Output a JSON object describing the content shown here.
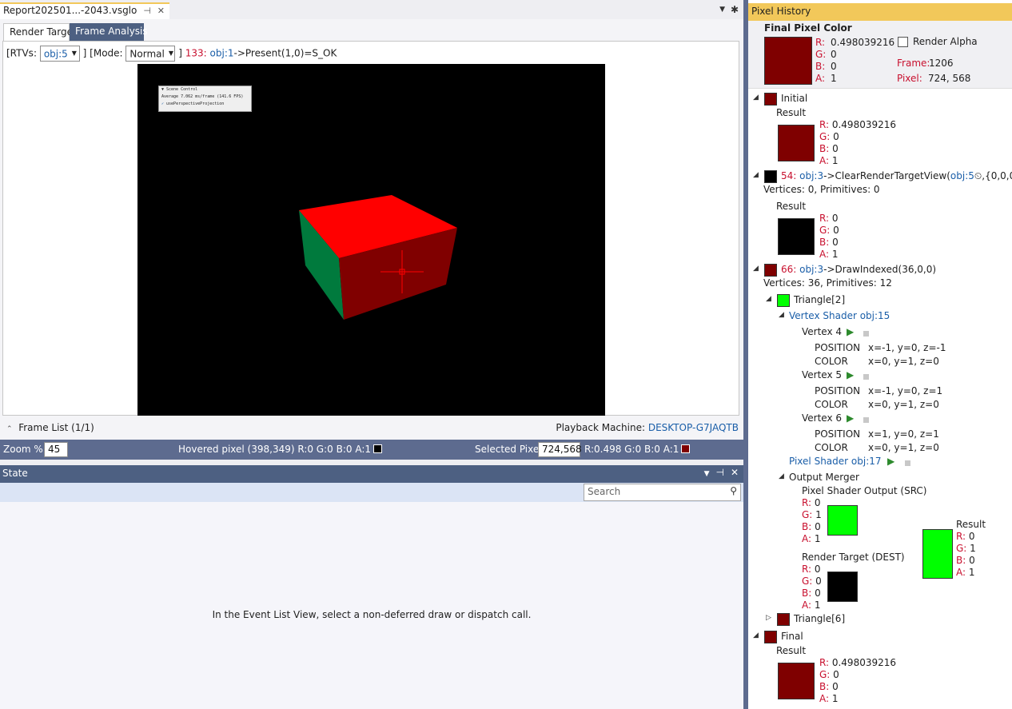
{
  "document_tab": {
    "title": "Report202501...-2043.vsglog",
    "pin": "⊣",
    "close": "✕",
    "menu": "▼",
    "gear": "✱"
  },
  "subtabs": {
    "render_target": "Render Target",
    "frame_analysis": "Frame Analysis"
  },
  "rtv_bar": {
    "rtvs_label": "[RTVs:",
    "rtv_value": "obj:5",
    "close_bracket": "]",
    "mode_label": "[Mode:",
    "mode_value": "Normal",
    "close_bracket2": "]",
    "call_index": "133:",
    "call_obj": "obj:1",
    "call_text": "->Present(1,0)=S_OK"
  },
  "scene_overlay": {
    "title": "▼ Scene Control",
    "line1": "Average 7.062 ms/frame (141.6 FPS)",
    "line2": "usePerspectiveProjection",
    "check": "✓"
  },
  "frame_list": {
    "label": "Frame List (1/1)",
    "playback_label": "Playback Machine:",
    "playback_value": "DESKTOP-G7JAQTB"
  },
  "zoom_bar": {
    "zoom_label": "Zoom %",
    "zoom_value": "45",
    "hovered_label": "Hovered pixel (398,349) R:0 G:0 B:0 A:1",
    "hovered_color": "#000000",
    "selected_label": "Selected Pixel",
    "selected_value": "724,568",
    "selected_rgba": "R:0.498 G:0 B:0 A:1",
    "selected_color": "#7f0000"
  },
  "state": {
    "title": "State",
    "search_placeholder": "Search",
    "empty_message": "In the Event List View, select a non-deferred draw or dispatch call."
  },
  "pixel_history": {
    "title": "Pixel History",
    "final_pixel": {
      "heading": "Final Pixel Color",
      "r_label": "R:",
      "r": "0.498039216",
      "g_label": "G:",
      "g": "0",
      "b_label": "B:",
      "b": "0",
      "a_label": "A:",
      "a": "1",
      "render_alpha": "Render Alpha",
      "frame_label": "Frame:",
      "frame": "1206",
      "pixel_label": "Pixel:",
      "pixel": "724, 568",
      "color": "#7f0000"
    },
    "initial": {
      "label": "Initial",
      "result_label": "Result",
      "r": "0.498039216",
      "g": "0",
      "b": "0",
      "a": "1",
      "color": "#7f0000"
    },
    "clear": {
      "index": "54:",
      "obj": "obj:3",
      "call": "->ClearRenderTargetView(",
      "arg_obj": "obj:5",
      "rest": ",{0,0,0,1})",
      "stats": "Vertices: 0, Primitives: 0",
      "result_label": "Result",
      "r": "0",
      "g": "0",
      "b": "0",
      "a": "1",
      "color": "#000000"
    },
    "draw": {
      "index": "66:",
      "obj": "obj:3",
      "call": "->DrawIndexed(36,0,0)",
      "stats": "Vertices: 36, Primitives: 12",
      "color": "#7f0000",
      "triangle": "Triangle[2]",
      "triangle_color": "#00ff00",
      "vertex_shader": "Vertex Shader obj:15",
      "vertices": [
        {
          "label": "Vertex 4",
          "position_label": "POSITION",
          "position": "x=-1, y=0, z=-1",
          "color_label": "COLOR",
          "color": "x=0, y=1, z=0"
        },
        {
          "label": "Vertex 5",
          "position_label": "POSITION",
          "position": "x=-1, y=0, z=1",
          "color_label": "COLOR",
          "color": "x=0, y=1, z=0"
        },
        {
          "label": "Vertex 6",
          "position_label": "POSITION",
          "position": "x=1, y=0, z=1",
          "color_label": "COLOR",
          "color": "x=0, y=1, z=0"
        }
      ],
      "pixel_shader": "Pixel Shader obj:17",
      "output_merger": "Output Merger",
      "src": {
        "label": "Pixel Shader Output (SRC)",
        "r": "0",
        "g": "1",
        "b": "0",
        "a": "1",
        "color": "#00ff00"
      },
      "dest": {
        "label": "Render Target (DEST)",
        "r": "0",
        "g": "0",
        "b": "0",
        "a": "1",
        "color": "#000000"
      },
      "result": {
        "label": "Result",
        "r": "0",
        "g": "1",
        "b": "0",
        "a": "1",
        "color": "#00ff00"
      },
      "triangle6": "Triangle[6]",
      "triangle6_color": "#7f0000"
    },
    "final": {
      "label": "Final",
      "result_label": "Result",
      "r": "0.498039216",
      "g": "0",
      "b": "0",
      "a": "1",
      "color": "#7f0000"
    }
  }
}
